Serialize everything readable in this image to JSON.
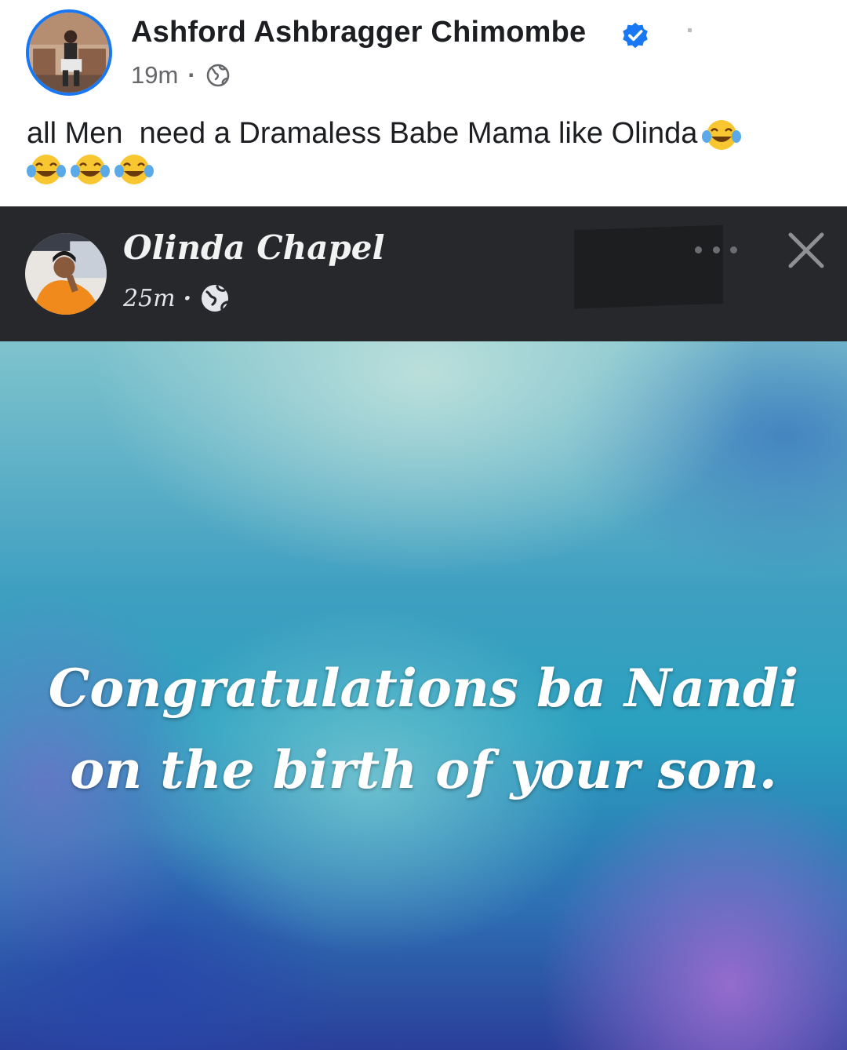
{
  "outer_post": {
    "author_name": "Ashford Ashbragger Chimombe",
    "verified_badge_icon": "verified-checkmark-icon",
    "time": "19m",
    "separator": "·",
    "audience_icon": "globe-icon",
    "caption": "all Men  need a Dramaless Babe Mama like Olinda",
    "emoji_icon": "face-with-tears-of-joy-emoji",
    "emoji_count": 4
  },
  "shared_post": {
    "author_name": "Olinda Chapel",
    "time": "25m",
    "separator": "·",
    "audience_icon": "globe-icon",
    "menu_icon": "more-options-icon",
    "close_icon": "close-icon",
    "card_text": "Congratulations ba Nandi on the birth of your son."
  },
  "colors": {
    "verified_blue": "#1877f2",
    "dark_header": "#27282b",
    "card_text": "#ffffff"
  }
}
